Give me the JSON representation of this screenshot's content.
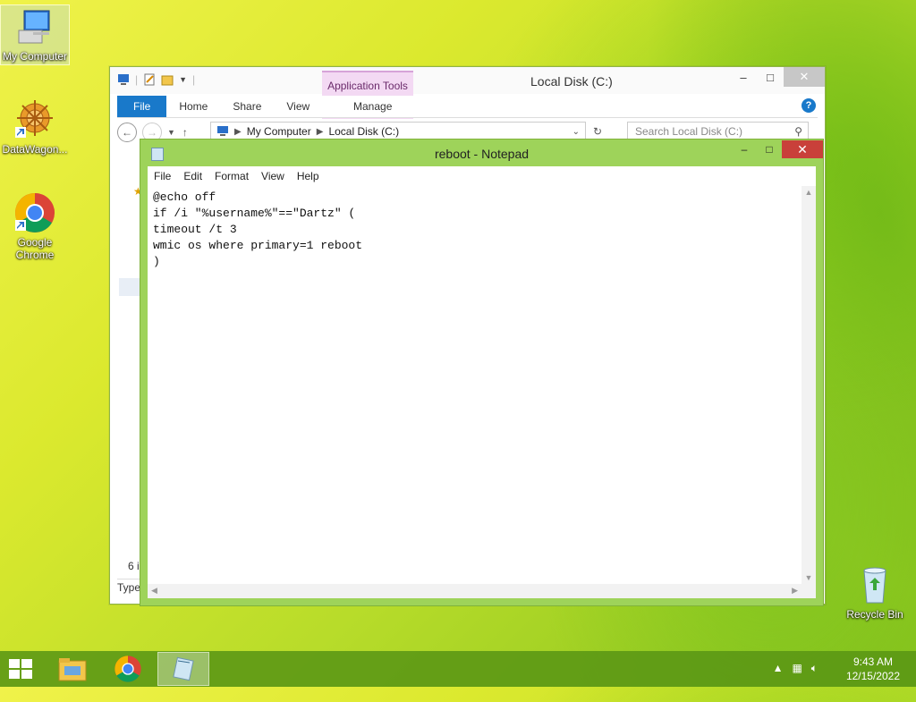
{
  "desktop": {
    "icons": [
      {
        "label": "My Computer"
      },
      {
        "label": "DataWagon..."
      },
      {
        "label": "Google Chrome"
      },
      {
        "label": "Recycle Bin"
      }
    ]
  },
  "explorer": {
    "title": "Local Disk (C:)",
    "context_tab": "Application Tools",
    "ribbon_tabs": [
      "File",
      "Home",
      "Share",
      "View",
      "Manage"
    ],
    "breadcrumb": [
      "My Computer",
      "Local Disk (C:)"
    ],
    "search_placeholder": "Search Local Disk (C:)",
    "status_fragment": "6 i",
    "column_fragment": "Type"
  },
  "notepad": {
    "title": "reboot - Notepad",
    "menu": [
      "File",
      "Edit",
      "Format",
      "View",
      "Help"
    ],
    "content": "@echo off\nif /i \"%username%\"==\"Dartz\" (\ntimeout /t 3\nwmic os where primary=1 reboot\n)"
  },
  "taskbar": {
    "time": "9:43 AM",
    "date": "12/15/2022"
  },
  "colors": {
    "accent_blue": "#1979ca",
    "notepad_frame": "#9ed35a",
    "close_red": "#c9403a",
    "taskbar": "#5a9614"
  }
}
